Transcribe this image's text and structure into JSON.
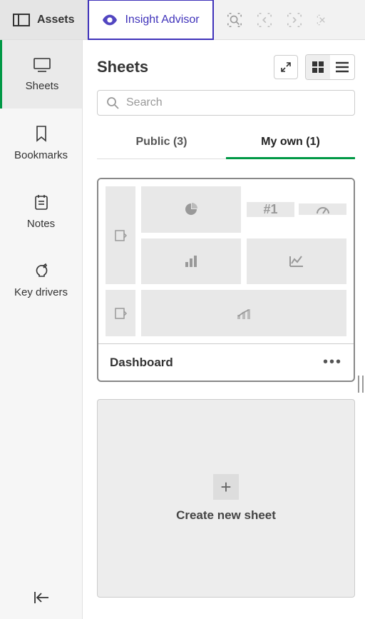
{
  "topbar": {
    "assets_label": "Assets",
    "insight_label": "Insight Advisor"
  },
  "sidebar": {
    "items": [
      {
        "label": "Sheets"
      },
      {
        "label": "Bookmarks"
      },
      {
        "label": "Notes"
      },
      {
        "label": "Key drivers"
      }
    ]
  },
  "main": {
    "title": "Sheets",
    "search_placeholder": "Search",
    "tabs": [
      {
        "label": "Public (3)"
      },
      {
        "label": "My own (1)"
      }
    ],
    "sheet": {
      "name": "Dashboard",
      "kpi_label": "#1"
    },
    "create_label": "Create new sheet"
  }
}
